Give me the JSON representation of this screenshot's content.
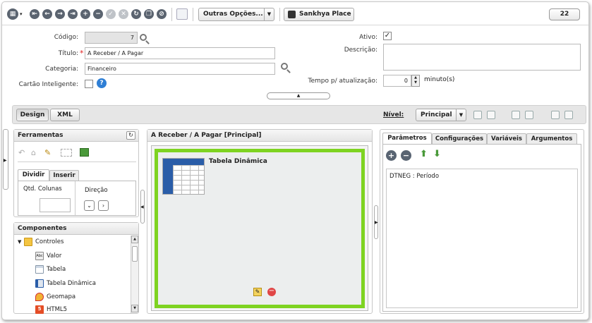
{
  "toolbar": {
    "more_options_label": "Outras Opções...",
    "place_label": "Sankhya Place",
    "record_count": "22"
  },
  "form": {
    "codigo_label": "Código:",
    "codigo_value": "7",
    "titulo_label": "Título:",
    "titulo_value": "A Receber / A Pagar",
    "categoria_label": "Categoria:",
    "categoria_value": "Financeiro",
    "cartao_label": "Cartão Inteligente:",
    "ativo_label": "Ativo:",
    "ativo_checked": "✓",
    "descricao_label": "Descrição:",
    "descricao_value": "",
    "tempo_label": "Tempo p/ atualização:",
    "tempo_value": "0",
    "tempo_unit": "minuto(s)"
  },
  "design_bar": {
    "design_label": "Design",
    "xml_label": "XML",
    "nivel_label": "Nível:",
    "nivel_value": "Principal"
  },
  "ferramentas": {
    "title": "Ferramentas",
    "tabs": [
      "Dividir",
      "Inserir"
    ],
    "qtd_colunas_label": "Qtd. Colunas",
    "qtd_colunas_value": "",
    "direcao_label": "Direção"
  },
  "componentes": {
    "title": "Componentes",
    "items": [
      {
        "label": "Controles",
        "icon": "folder-icon"
      },
      {
        "label": "Valor",
        "icon": "abc-icon"
      },
      {
        "label": "Tabela",
        "icon": "table-icon"
      },
      {
        "label": "Tabela Dinâmica",
        "icon": "pivot-table-icon"
      },
      {
        "label": "Geomapa",
        "icon": "map-icon"
      },
      {
        "label": "HTML5",
        "icon": "html5-icon"
      }
    ]
  },
  "center": {
    "title": "A Receber / A Pagar [Principal]",
    "component_label": "Tabela Dinâmica"
  },
  "right": {
    "tabs": [
      "Parâmetros",
      "Configurações",
      "Variáveis",
      "Argumentos"
    ],
    "params": [
      "DTNEG : Período"
    ]
  },
  "colors": {
    "accent_green": "#7ed321",
    "required": "#e02020",
    "help_blue": "#2f7fd5"
  }
}
